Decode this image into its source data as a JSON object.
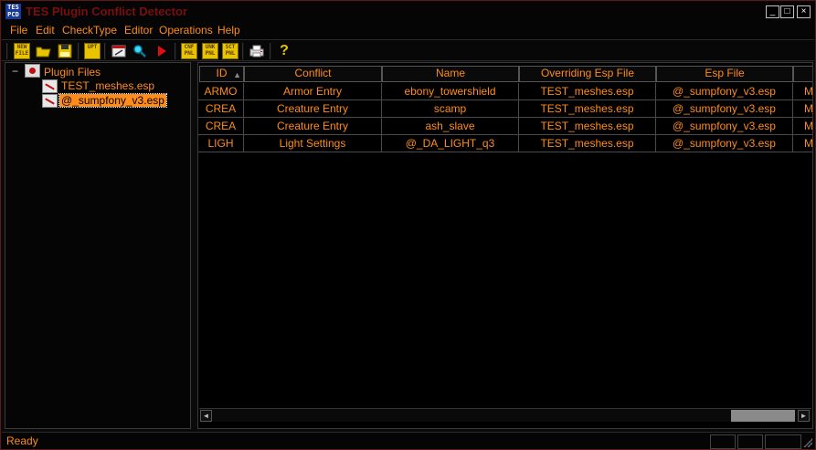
{
  "window": {
    "title": "TES Plugin Conflict Detector",
    "icon_text": "TES PCD",
    "buttons": {
      "minimize": "_",
      "maximize": "□",
      "close": "×"
    }
  },
  "menu": [
    {
      "label": "File"
    },
    {
      "label": "Edit"
    },
    {
      "label": "CheckType"
    },
    {
      "label": "Editor"
    },
    {
      "label": "Operations"
    },
    {
      "label": "Help"
    }
  ],
  "toolbar": {
    "new_text": "NEW FILE",
    "open_icon": "open-folder-icon",
    "save_icon": "save-disk-icon",
    "upt_text": "UPT",
    "edit_icon": "edit-window-icon",
    "search_icon": "magnifier-icon",
    "run_icon": "play-arrow-icon",
    "cnf_text": "CNF PNL",
    "unk_text": "UNK PNL",
    "sct_text": "SCT PNL",
    "print_icon": "printer-icon",
    "help_text": "?"
  },
  "tree": {
    "toggle": "−",
    "root_label": "Plugin Files",
    "children": [
      {
        "label": "TEST_meshes.esp",
        "selected": false
      },
      {
        "label": "@_sumpfony_v3.esp",
        "selected": true
      }
    ]
  },
  "table": {
    "columns": [
      "ID",
      "Conflict",
      "Name",
      "Overriding Esp File",
      "Esp File",
      ""
    ],
    "sort_indicator": "▲",
    "rows": [
      {
        "id": "ARMO",
        "conflict": "Armor Entry",
        "name": "ebony_towershield",
        "overriding": "TEST_meshes.esp",
        "esp": "@_sumpfony_v3.esp",
        "extra": "M"
      },
      {
        "id": "CREA",
        "conflict": "Creature Entry",
        "name": "scamp",
        "overriding": "TEST_meshes.esp",
        "esp": "@_sumpfony_v3.esp",
        "extra": "M"
      },
      {
        "id": "CREA",
        "conflict": "Creature Entry",
        "name": "ash_slave",
        "overriding": "TEST_meshes.esp",
        "esp": "@_sumpfony_v3.esp",
        "extra": "M"
      },
      {
        "id": "LIGH",
        "conflict": "Light Settings",
        "name": "@_DA_LIGHT_q3",
        "overriding": "TEST_meshes.esp",
        "esp": "@_sumpfony_v3.esp",
        "extra": "M"
      }
    ]
  },
  "scrollbar": {
    "left": "◄",
    "right": "►"
  },
  "status": {
    "text": "Ready"
  },
  "colors": {
    "text": "#ff8c1a",
    "title": "#7a0f0f",
    "background": "#000000",
    "toolbar_yellow": "#e8c400"
  }
}
